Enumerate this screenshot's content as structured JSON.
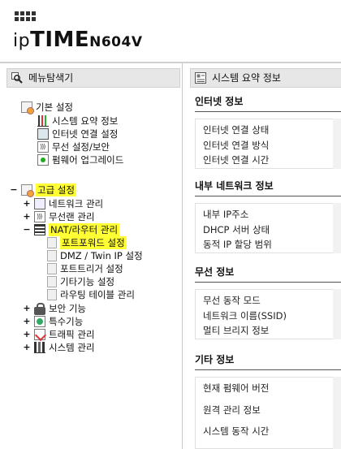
{
  "header": {
    "brand_ip": "ip",
    "brand_time": "TIME",
    "model": "N604V"
  },
  "left_panel": {
    "title": "메뉴탐색기",
    "title_icon": "magnifier-tree-icon",
    "basic": {
      "label": "기본 설정",
      "items": [
        {
          "label": "시스템 요약 정보",
          "icon": "bar-chart-icon"
        },
        {
          "label": "인터넷 연결 설정",
          "icon": "monitor-icon"
        },
        {
          "label": "무선 설정/보안",
          "icon": "wifi-icon"
        },
        {
          "label": "펌웨어 업그레이드",
          "icon": "update-icon"
        }
      ]
    },
    "advanced": {
      "toggle": "−",
      "label": "고급 설정",
      "items": [
        {
          "toggle": "+",
          "label": "네트워크 관리",
          "icon": "network-icon"
        },
        {
          "toggle": "+",
          "label": "무선랜 관리",
          "icon": "wifi-icon"
        },
        {
          "toggle": "−",
          "label": "NAT/라우터 관리",
          "icon": "nat-icon",
          "children": [
            {
              "label": "포트포워드 설정"
            },
            {
              "label": "DMZ / Twin IP 설정"
            },
            {
              "label": "포트트리거 설정"
            },
            {
              "label": "기타기능 설정"
            },
            {
              "label": "라우팅 테이블 관리"
            }
          ]
        },
        {
          "toggle": "+",
          "label": "보안 기능",
          "icon": "lock-icon"
        },
        {
          "toggle": "+",
          "label": "특수기능",
          "icon": "special-icon"
        },
        {
          "toggle": "+",
          "label": "트래픽 관리",
          "icon": "traffic-icon"
        },
        {
          "toggle": "+",
          "label": "시스템 관리",
          "icon": "system-icon"
        }
      ]
    }
  },
  "right_panel": {
    "title": "시스템 요약 정보",
    "title_icon": "summary-icon",
    "sections": [
      {
        "title": "인터넷 정보",
        "rows": [
          "인터넷 연결 상태",
          "인터넷 연결 방식",
          "인터넷 연결 시간"
        ]
      },
      {
        "title": "내부 네트워크 정보",
        "rows": [
          "내부 IP주소",
          "DHCP 서버 상태",
          "동적 IP 할당 범위"
        ]
      },
      {
        "title": "무선 정보",
        "rows": [
          "무선 동작 모드",
          "네트워크 이름(SSID)",
          "멀티 브리지 정보"
        ]
      },
      {
        "title": "기타 정보",
        "rows": [
          "현재 펌웨어 버전",
          "원격 관리 정보",
          "시스템 동작 시간"
        ]
      }
    ]
  },
  "colors": {
    "highlight": "#ffff33",
    "panel_header_bg": "#e7e7e7"
  }
}
